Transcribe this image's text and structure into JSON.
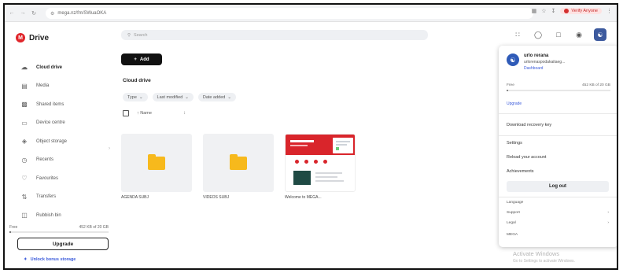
{
  "browser": {
    "url": "mega.nz/fm/SWuaOKA",
    "profile_label": "Verify Anyone"
  },
  "brand": {
    "name": "Drive"
  },
  "sidebar": {
    "items": [
      {
        "label": "Cloud drive",
        "icon": "cloud-icon"
      },
      {
        "label": "Media",
        "icon": "media-icon"
      },
      {
        "label": "Shared items",
        "icon": "shared-icon"
      },
      {
        "label": "Device centre",
        "icon": "device-icon"
      },
      {
        "label": "Object storage",
        "icon": "object-storage-icon"
      },
      {
        "label": "Recents",
        "icon": "clock-icon"
      },
      {
        "label": "Favourites",
        "icon": "heart-icon"
      },
      {
        "label": "Transfers",
        "icon": "transfers-icon"
      },
      {
        "label": "Rubbish bin",
        "icon": "trash-icon"
      }
    ],
    "storage_plan": "Free",
    "storage_used": "452 KB of 20 GB",
    "storage_fraction": 0.01,
    "upgrade_label": "Upgrade",
    "bonus_label": "Unlock bonus storage"
  },
  "search": {
    "placeholder": "Search"
  },
  "toolbar": {
    "add_label": "Add"
  },
  "main": {
    "breadcrumb": "Cloud drive",
    "filters": [
      "Type",
      "Last modified",
      "Date added"
    ],
    "sort_label": "Name",
    "items": [
      {
        "name": "AGENDA SUBJ",
        "kind": "folder"
      },
      {
        "name": "VIDEOS SUBJ",
        "kind": "folder"
      },
      {
        "name": "Welcome to MEGA...",
        "kind": "pdf"
      }
    ]
  },
  "account_menu": {
    "name": "urlo rerana",
    "email": "urlorenaspodakaitaeg...",
    "dashboard_label": "Dashboard",
    "plan": "Free",
    "storage": "452 KB of 20 GB",
    "storage_fraction": 0.01,
    "upgrade_label": "Upgrade",
    "download_key_label": "Download recovery key",
    "settings_label": "Settings",
    "reload_label": "Reload your account",
    "achievements_label": "Achievements",
    "logout_label": "Log out",
    "language_label": "Language",
    "support_label": "Support",
    "legal_label": "Legal",
    "version_label": "MEGA"
  },
  "watermark": {
    "title": "Activate Windows",
    "subtitle": "Go to Settings to activate Windows."
  },
  "colors": {
    "brand_red": "#e0262b",
    "accent_blue": "#3b5bdb",
    "folder_yellow": "#f7b91c"
  }
}
